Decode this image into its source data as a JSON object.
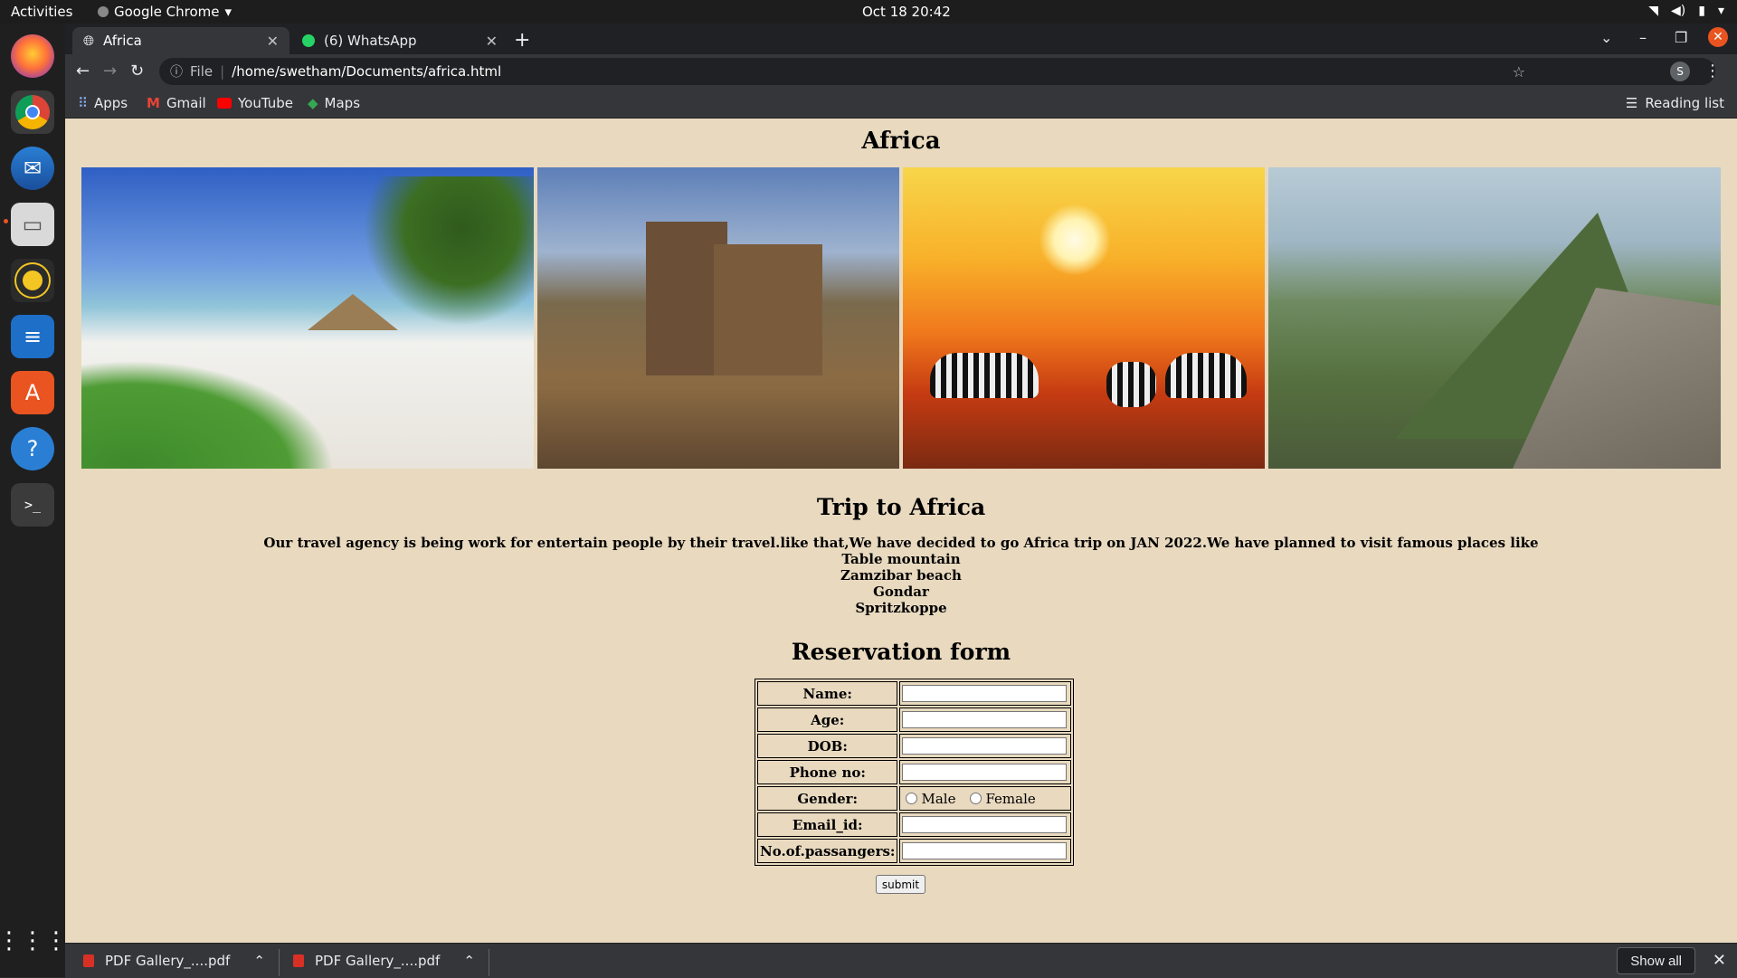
{
  "os": {
    "activities": "Activities",
    "app_menu": "Google Chrome",
    "clock": "Oct 18  20:42"
  },
  "dock": {
    "items": [
      "firefox-icon",
      "chrome-icon",
      "thunderbird-icon",
      "files-icon",
      "rhythmbox-icon",
      "libreoffice-writer-icon",
      "software-icon",
      "help-icon",
      "terminal-icon",
      "app-grid-icon"
    ]
  },
  "tabs": [
    {
      "label": "Africa",
      "active": true
    },
    {
      "label": "(6) WhatsApp",
      "active": false
    }
  ],
  "omnibox": {
    "scheme": "File",
    "url": "/home/swetham/Documents/africa.html"
  },
  "profile_initial": "S",
  "bookmarks": [
    {
      "label": "Apps",
      "icon": "apps-grid-icon"
    },
    {
      "label": "Gmail",
      "icon": "gmail-icon"
    },
    {
      "label": "YouTube",
      "icon": "youtube-icon"
    },
    {
      "label": "Maps",
      "icon": "maps-icon"
    }
  ],
  "reading_list": "Reading list",
  "page": {
    "title": "Africa",
    "photos": [
      "beach-photo",
      "castle-photo",
      "zebra-sunset-photo",
      "mountain-photo"
    ],
    "trip_heading": "Trip to Africa",
    "intro": "Our travel agency is being work for entertain people by their travel.like that,We have decided to go Africa trip on JAN 2022.We have planned to visit famous places like",
    "places": [
      "Table mountain",
      "Zamzibar beach",
      "Gondar",
      "Spritzkoppe"
    ],
    "form_heading": "Reservation form",
    "form": {
      "name_label": "Name:",
      "age_label": "Age:",
      "dob_label": "DOB:",
      "phone_label": "Phone no:",
      "gender_label": "Gender:",
      "gender_male": "Male",
      "gender_female": "Female",
      "email_label": "Email_id:",
      "passengers_label": "No.of.passangers:",
      "submit": "submit"
    }
  },
  "downloads": [
    {
      "name": "PDF Gallery_....pdf"
    },
    {
      "name": "PDF Gallery_....pdf"
    }
  ],
  "show_all": "Show all"
}
